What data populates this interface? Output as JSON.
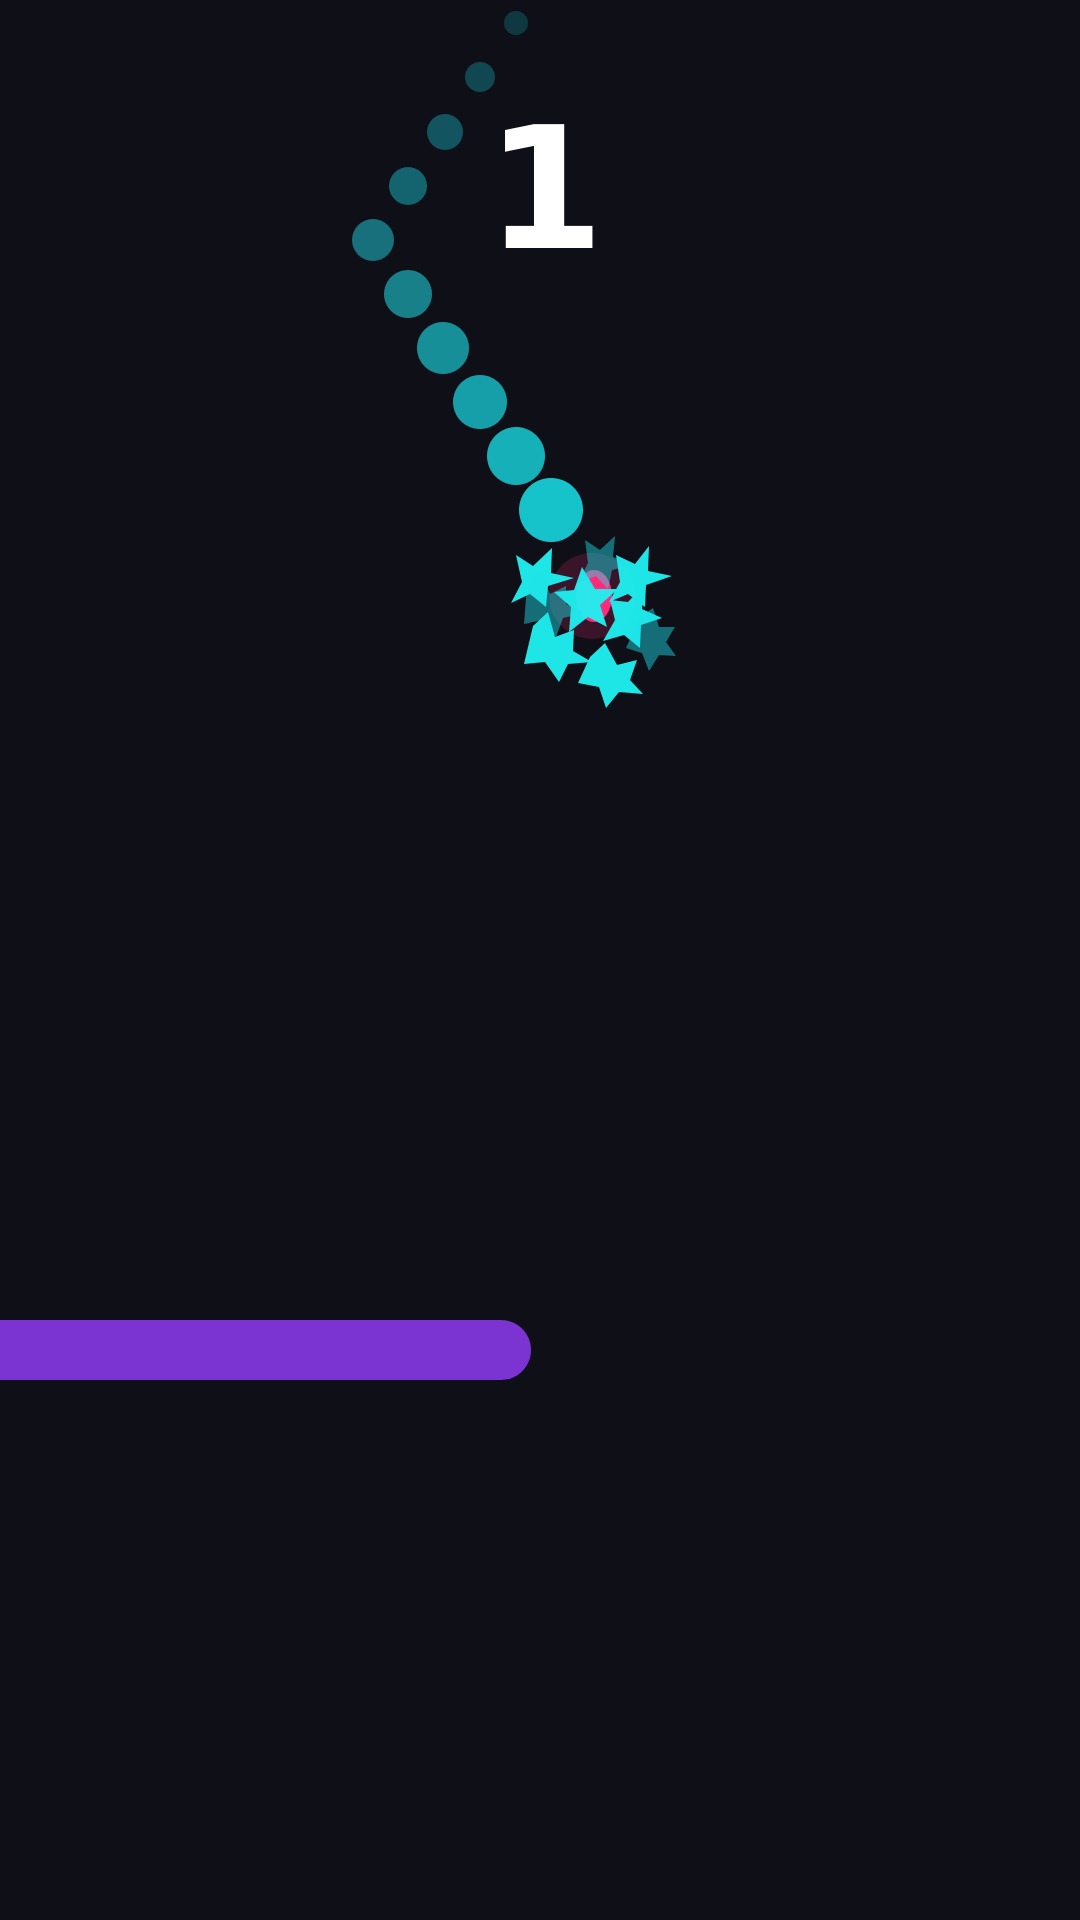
{
  "game": {
    "score": "1",
    "colors": {
      "background": "#0f0f18",
      "trail": "#18c7cf",
      "burst": "#20f2f2",
      "impact": "#ff2a7a",
      "platform": "#7b33d1",
      "score": "#ffffff"
    }
  }
}
